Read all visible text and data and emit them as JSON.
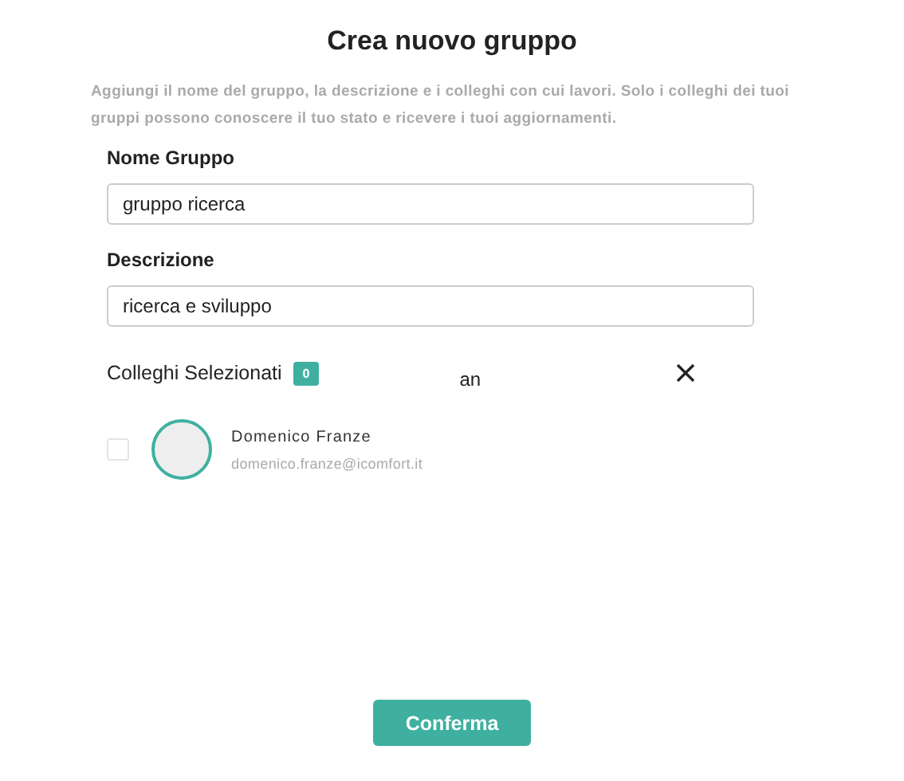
{
  "title": "Crea nuovo gruppo",
  "description": "Aggiungi il nome del gruppo, la descrizione e i colleghi con cui lavori. Solo i colleghi dei tuoi gruppi possono conoscere il tuo stato e ricevere i tuoi aggiornamenti.",
  "fields": [
    {
      "label": "Nome Gruppo",
      "value": "gruppo ricerca"
    },
    {
      "label": "Descrizione",
      "value": "ricerca e sviluppo"
    }
  ],
  "colleagues": {
    "label": "Colleghi Selezionati",
    "count": "0",
    "search": {
      "value": "an"
    }
  },
  "contacts": [
    {
      "name": "Domenico Franze",
      "email": "domenico.franze@icomfort.it",
      "checked": false
    }
  ],
  "confirm_button": "Conferma"
}
